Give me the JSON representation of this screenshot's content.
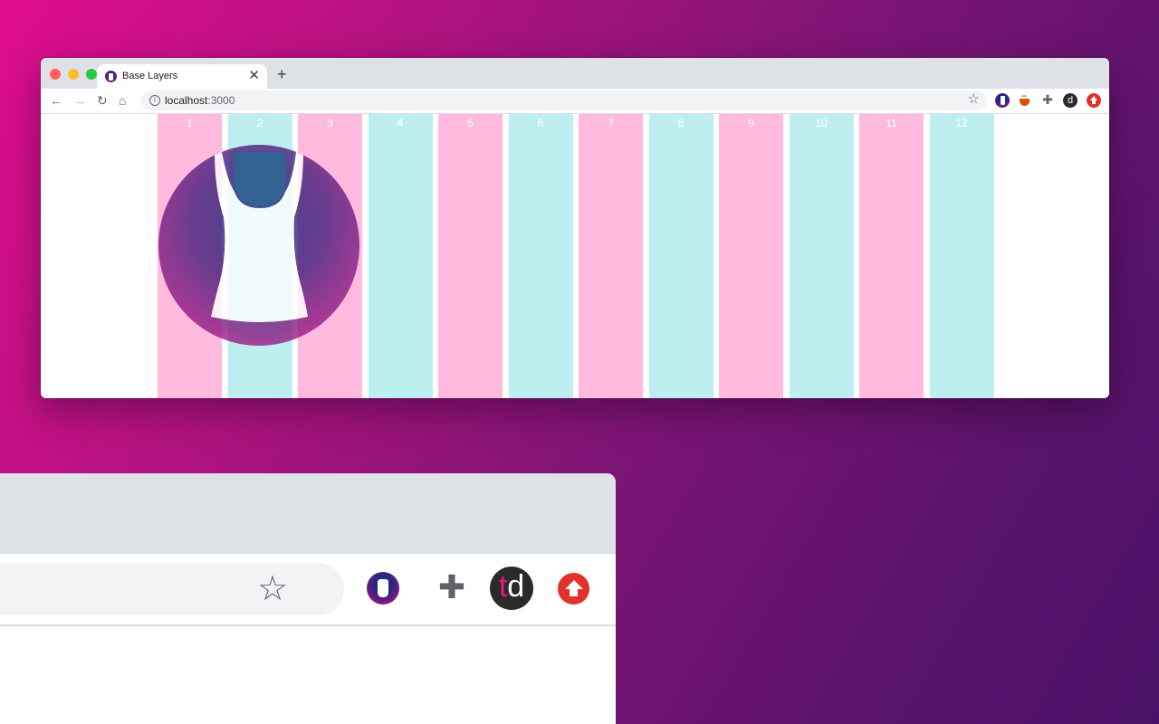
{
  "window": {
    "tab": {
      "title": "Base Layers",
      "close_glyph": "✕",
      "favicon": "tank-top-logo-icon"
    },
    "new_tab_glyph": "+",
    "toolbar": {
      "back_glyph": "←",
      "forward_glyph": "→",
      "reload_glyph": "↻",
      "home_glyph": "⌂",
      "url_host": "localhost",
      "url_port": ":3000",
      "info_glyph": "i",
      "star_glyph": "☆",
      "extensions": [
        "tank-top-logo-icon",
        "coffee-cup-icon",
        "puzzle-icon",
        "td-icon",
        "upload-arrow-icon"
      ],
      "td_label": "d",
      "puzzle_glyph": "✚"
    }
  },
  "grid": {
    "columns": [
      "1",
      "2",
      "3",
      "4",
      "5",
      "6",
      "7",
      "8",
      "9",
      "10",
      "11",
      "12"
    ],
    "colors": {
      "pink": "#ffbade",
      "cyan": "#bdeff0"
    }
  },
  "zoom": {
    "star_glyph": "☆",
    "puzzle_glyph": "✚",
    "td_t": "t",
    "td_d": "d",
    "extensions": [
      "tank-top-logo-icon",
      "puzzle-icon",
      "td-icon",
      "upload-arrow-icon"
    ]
  }
}
